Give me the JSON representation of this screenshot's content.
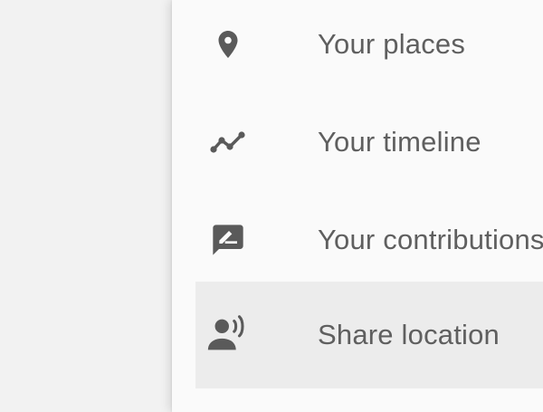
{
  "menu": {
    "items": [
      {
        "label": "Your places",
        "icon": "place-pin-icon",
        "active": false
      },
      {
        "label": "Your timeline",
        "icon": "timeline-icon",
        "active": false
      },
      {
        "label": "Your contributions",
        "icon": "contributions-icon",
        "active": false
      },
      {
        "label": "Share location",
        "icon": "share-location-icon",
        "active": true
      }
    ]
  },
  "colors": {
    "page_background": "#f2f2f2",
    "panel_background": "#fafafa",
    "active_row_background": "#ececec",
    "icon_color": "#5a5a5a",
    "label_color": "#5f5f5f"
  }
}
